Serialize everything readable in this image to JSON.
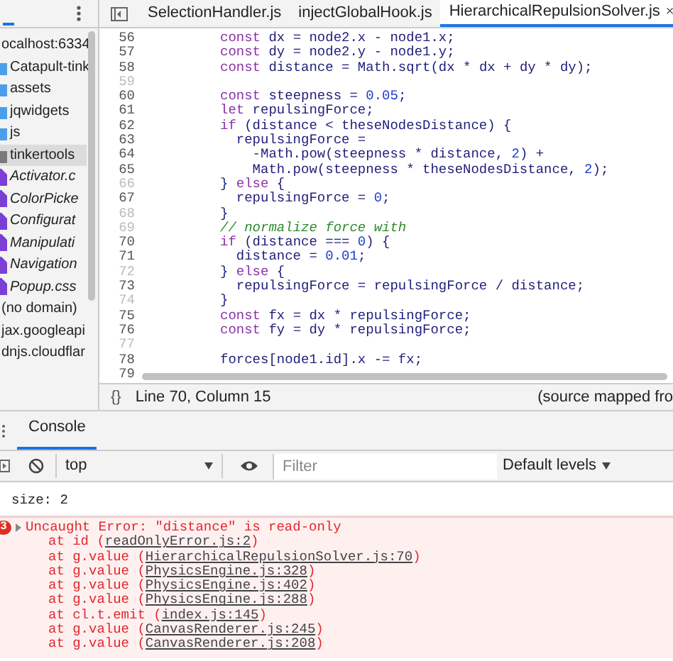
{
  "navigator": {
    "items": [
      {
        "label": "ocalhost:6334",
        "kind": "origin",
        "selected": false,
        "children": [
          {
            "label": "Catapult-tink",
            "kind": "folder",
            "color": "#4a9eea",
            "selected": false,
            "children": [
              {
                "label": "assets",
                "kind": "folder",
                "color": "#4a9eea",
                "selected": false
              },
              {
                "label": "jqwidgets",
                "kind": "folder",
                "color": "#4a9eea",
                "selected": false
              },
              {
                "label": "js",
                "kind": "folder",
                "color": "#4a9eea",
                "selected": false
              },
              {
                "label": "tinkertools",
                "kind": "folder",
                "color": "#7a7a7a",
                "selected": true,
                "children": [
                  {
                    "label": "Activator.c",
                    "kind": "file",
                    "selected": false
                  },
                  {
                    "label": "ColorPicke",
                    "kind": "file",
                    "selected": false
                  },
                  {
                    "label": "Configurat",
                    "kind": "file",
                    "selected": false
                  },
                  {
                    "label": "Manipulati",
                    "kind": "file",
                    "selected": false
                  },
                  {
                    "label": "Navigation",
                    "kind": "file",
                    "selected": false
                  },
                  {
                    "label": "Popup.css",
                    "kind": "file",
                    "selected": false
                  }
                ]
              }
            ]
          }
        ]
      },
      {
        "label": "(no domain)",
        "kind": "origin",
        "selected": false
      },
      {
        "label": "jax.googleapi",
        "kind": "origin",
        "selected": false
      },
      {
        "label": "dnjs.cloudflar",
        "kind": "origin",
        "selected": false
      }
    ]
  },
  "editor": {
    "tabs": [
      {
        "label": "SelectionHandler.js",
        "selected": false,
        "closable": false
      },
      {
        "label": "injectGlobalHook.js",
        "selected": false,
        "closable": false
      },
      {
        "label": "HierarchicalRepulsionSolver.js",
        "selected": true,
        "closable": true,
        "close": "×"
      }
    ],
    "lines": [
      {
        "number": "56",
        "dimmed": false,
        "tokens": [
          {
            "kind": "keyword",
            "text": "const"
          },
          {
            "kind": "code",
            "text": " dx = node2.x - node1.x;"
          }
        ]
      },
      {
        "number": "57",
        "dimmed": false,
        "tokens": [
          {
            "kind": "keyword",
            "text": "const"
          },
          {
            "kind": "code",
            "text": " dy = node2.y - node1.y;"
          }
        ]
      },
      {
        "number": "58",
        "dimmed": false,
        "tokens": [
          {
            "kind": "keyword",
            "text": "const"
          },
          {
            "kind": "code",
            "text": " distance = Math.sqrt(dx * dx + dy * dy);"
          }
        ]
      },
      {
        "number": "59",
        "dimmed": true
      },
      {
        "number": "60",
        "dimmed": false,
        "tokens": [
          {
            "kind": "keyword",
            "text": "const"
          },
          {
            "kind": "code",
            "text": " steepness = "
          },
          {
            "kind": "number",
            "text": "0.05"
          },
          {
            "kind": "code",
            "text": ";"
          }
        ]
      },
      {
        "number": "61",
        "dimmed": false,
        "tokens": [
          {
            "kind": "keyword",
            "text": "let"
          },
          {
            "kind": "code",
            "text": " repulsingForce;"
          }
        ]
      },
      {
        "number": "62",
        "dimmed": false,
        "tokens": [
          {
            "kind": "keyword",
            "text": "if"
          },
          {
            "kind": "code",
            "text": " (distance < theseNodesDistance) {"
          }
        ]
      },
      {
        "number": "63",
        "dimmed": false,
        "tokens": [
          {
            "kind": "code",
            "text": "  repulsingForce ="
          }
        ]
      },
      {
        "number": "64",
        "dimmed": false,
        "tokens": [
          {
            "kind": "code",
            "text": "    -Math.pow(steepness * distance, "
          },
          {
            "kind": "number",
            "text": "2"
          },
          {
            "kind": "code",
            "text": ") +"
          }
        ]
      },
      {
        "number": "65",
        "dimmed": false,
        "tokens": [
          {
            "kind": "code",
            "text": "    Math.pow(steepness * theseNodesDistance, "
          },
          {
            "kind": "number",
            "text": "2"
          },
          {
            "kind": "code",
            "text": ");"
          }
        ]
      },
      {
        "number": "66",
        "dimmed": true,
        "tokens": [
          {
            "kind": "code",
            "text": "} "
          },
          {
            "kind": "keyword",
            "text": "else"
          },
          {
            "kind": "code",
            "text": " {"
          }
        ]
      },
      {
        "number": "67",
        "dimmed": false,
        "tokens": [
          {
            "kind": "code",
            "text": "  repulsingForce = "
          },
          {
            "kind": "number",
            "text": "0"
          },
          {
            "kind": "code",
            "text": ";"
          }
        ]
      },
      {
        "number": "68",
        "dimmed": true,
        "tokens": [
          {
            "kind": "code",
            "text": "}"
          }
        ]
      },
      {
        "number": "69",
        "dimmed": true,
        "tokens": [
          {
            "kind": "comment",
            "text": "// normalize force with"
          }
        ]
      },
      {
        "number": "70",
        "dimmed": false,
        "tokens": [
          {
            "kind": "keyword",
            "text": "if"
          },
          {
            "kind": "code",
            "text": " (distance === "
          },
          {
            "kind": "number",
            "text": "0"
          },
          {
            "kind": "code",
            "text": ") {"
          }
        ]
      },
      {
        "number": "71",
        "dimmed": false,
        "tokens": [
          {
            "kind": "code",
            "text": "  distance = "
          },
          {
            "kind": "number",
            "text": "0.01"
          },
          {
            "kind": "code",
            "text": ";"
          }
        ]
      },
      {
        "number": "72",
        "dimmed": true,
        "tokens": [
          {
            "kind": "code",
            "text": "} "
          },
          {
            "kind": "keyword",
            "text": "else"
          },
          {
            "kind": "code",
            "text": " {"
          }
        ]
      },
      {
        "number": "73",
        "dimmed": false,
        "tokens": [
          {
            "kind": "code",
            "text": "  repulsingForce = repulsingForce / distance;"
          }
        ]
      },
      {
        "number": "74",
        "dimmed": true,
        "tokens": [
          {
            "kind": "code",
            "text": "}"
          }
        ]
      },
      {
        "number": "75",
        "dimmed": false,
        "tokens": [
          {
            "kind": "keyword",
            "text": "const"
          },
          {
            "kind": "code",
            "text": " fx = dx * repulsingForce;"
          }
        ]
      },
      {
        "number": "76",
        "dimmed": false,
        "tokens": [
          {
            "kind": "keyword",
            "text": "const"
          },
          {
            "kind": "code",
            "text": " fy = dy * repulsingForce;"
          }
        ]
      },
      {
        "number": "77",
        "dimmed": true
      },
      {
        "number": "78",
        "dimmed": false,
        "tokens": [
          {
            "kind": "code",
            "text": "forces[node1.id].x -= fx;"
          }
        ]
      },
      {
        "number": "79",
        "dimmed": false
      }
    ],
    "status": {
      "format": "{}",
      "position": "Line 70, Column 15",
      "source": "(source mapped fro"
    }
  },
  "drawer": {
    "tabs": [
      {
        "label": "Console",
        "selected": true
      }
    ],
    "context": "top",
    "filter": {
      "placeholder": "Filter"
    },
    "levels": "Default levels",
    "messages": [
      {
        "kind": "log",
        "text": "size: 2"
      },
      {
        "kind": "error",
        "count": "3",
        "text": "Uncaught Error: \"distance\" is read-only",
        "stack": [
          {
            "call": "at id (",
            "link": "readOnlyError.js:2",
            "end": ")"
          },
          {
            "call": "at g.value (",
            "link": "HierarchicalRepulsionSolver.js:70",
            "end": ")"
          },
          {
            "call": "at g.value (",
            "link": "PhysicsEngine.js:328",
            "end": ")"
          },
          {
            "call": "at g.value (",
            "link": "PhysicsEngine.js:402",
            "end": ")"
          },
          {
            "call": "at g.value (",
            "link": "PhysicsEngine.js:288",
            "end": ")"
          },
          {
            "call": "at cl.t.emit (",
            "link": "index.js:145",
            "end": ")"
          },
          {
            "call": "at g.value (",
            "link": "CanvasRenderer.js:245",
            "end": ")"
          },
          {
            "call": "at g.value (",
            "link": "CanvasRenderer.js:208",
            "end": ")"
          }
        ]
      }
    ]
  }
}
